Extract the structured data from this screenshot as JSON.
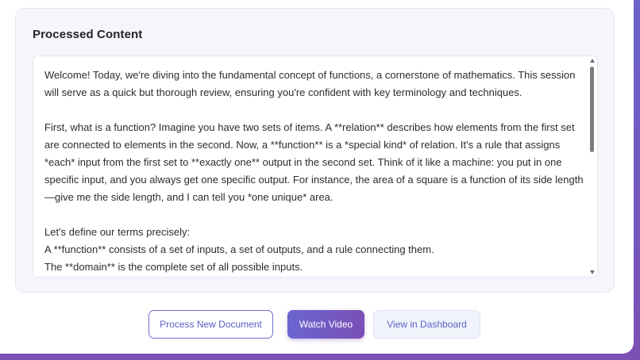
{
  "panel": {
    "title": "Processed Content",
    "paragraphs": [
      "Welcome! Today, we're diving into the fundamental concept of functions, a cornerstone of mathematics. This session will serve as a quick but thorough review, ensuring you're confident with key terminology and techniques.",
      "First, what is a function? Imagine you have two sets of items. A **relation** describes how elements from the first set are connected to elements in the second. Now, a **function** is a *special kind* of relation. It's a rule that assigns *each* input from the first set to **exactly one** output in the second set. Think of it like a machine: you put in one specific input, and you always get one specific output. For instance, the area of a square is a function of its side length—give me the side length, and I can tell you *one unique* area.",
      "Let's define our terms precisely:",
      "A **function** consists of a set of inputs, a set of outputs, and a rule connecting them.",
      "The **domain** is the complete set of all possible inputs."
    ]
  },
  "buttons": {
    "process_label": "Process New Document",
    "watch_label": "Watch Video",
    "dashboard_label": "View in Dashboard"
  },
  "colors": {
    "accent": "#6a66cf",
    "accent_end": "#7a4fb5",
    "panel_bg": "#f5f6fc"
  }
}
